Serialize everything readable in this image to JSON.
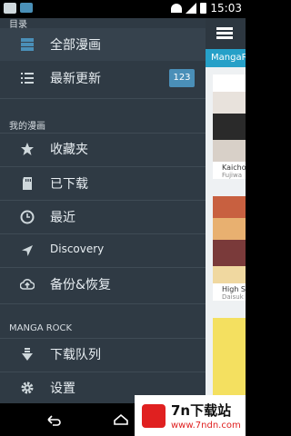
{
  "status": {
    "time": "15:03"
  },
  "app": {
    "tab_label": "MangaRe",
    "cards": [
      {
        "title": "Kaicho",
        "author": "Fujiwa"
      },
      {
        "title": "High S",
        "author": "Daisuk"
      }
    ]
  },
  "drawer": {
    "header": "目录",
    "items_top": [
      {
        "label": "全部漫画",
        "icon": "stack-icon",
        "active": true
      },
      {
        "label": "最新更新",
        "icon": "list-icon",
        "badge": "123"
      }
    ],
    "section_mine": "我的漫画",
    "items_mine": [
      {
        "label": "收藏夹",
        "icon": "star-icon"
      },
      {
        "label": "已下载",
        "icon": "sd-card-icon"
      },
      {
        "label": "最近",
        "icon": "clock-icon"
      },
      {
        "label": "Discovery",
        "icon": "navigation-arrow-icon"
      },
      {
        "label": "备份&恢复",
        "icon": "cloud-upload-icon"
      }
    ],
    "section_rock": "MANGA ROCK",
    "items_rock": [
      {
        "label": "下载队列",
        "icon": "download-queue-icon"
      },
      {
        "label": "设置",
        "icon": "gear-icon"
      }
    ]
  },
  "watermark": {
    "title": "7n下载站",
    "url": "www.7ndn.com"
  },
  "colors": {
    "drawer_bg": "#2f3a44",
    "accent": "#26a0c8",
    "badge": "#4a8fb8"
  }
}
